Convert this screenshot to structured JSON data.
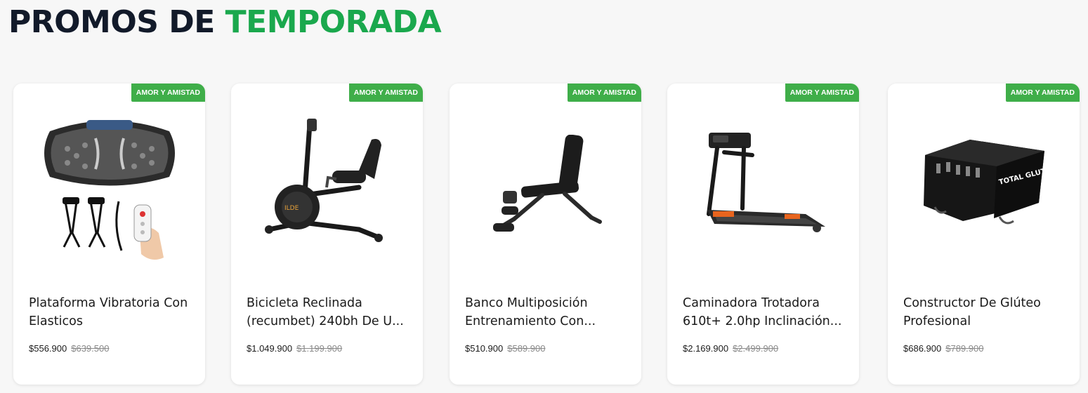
{
  "header": {
    "title_part1": "PROMOS DE",
    "title_part2": "TEMPORADA"
  },
  "colors": {
    "title_dark": "#121a2a",
    "title_accent": "#1aa84d",
    "badge_bg": "#3fae49"
  },
  "products": [
    {
      "badge": "AMOR Y AMISTAD",
      "name": "Plataforma Vibratoria Con Elasticos",
      "price": "$556.900",
      "old_price": "$639.500",
      "image_icon": "vibration-platform-icon"
    },
    {
      "badge": "AMOR Y AMISTAD",
      "name": "Bicicleta Reclinada (recumbet) 240bh De U...",
      "price": "$1.049.900",
      "old_price": "$1.199.900",
      "image_icon": "recumbent-bike-icon"
    },
    {
      "badge": "AMOR Y AMISTAD",
      "name": "Banco Multiposición Entrenamiento Con...",
      "price": "$510.900",
      "old_price": "$589.900",
      "image_icon": "weight-bench-icon"
    },
    {
      "badge": "AMOR Y AMISTAD",
      "name": "Caminadora Trotadora 610t+ 2.0hp Inclinación...",
      "price": "$2.169.900",
      "old_price": "$2.499.900",
      "image_icon": "treadmill-icon"
    },
    {
      "badge": "AMOR Y AMISTAD",
      "name": "Constructor De Glúteo Profesional",
      "price": "$686.900",
      "old_price": "$789.900",
      "image_icon": "glute-builder-icon",
      "image_text": "TOTAL GLUTE"
    }
  ]
}
